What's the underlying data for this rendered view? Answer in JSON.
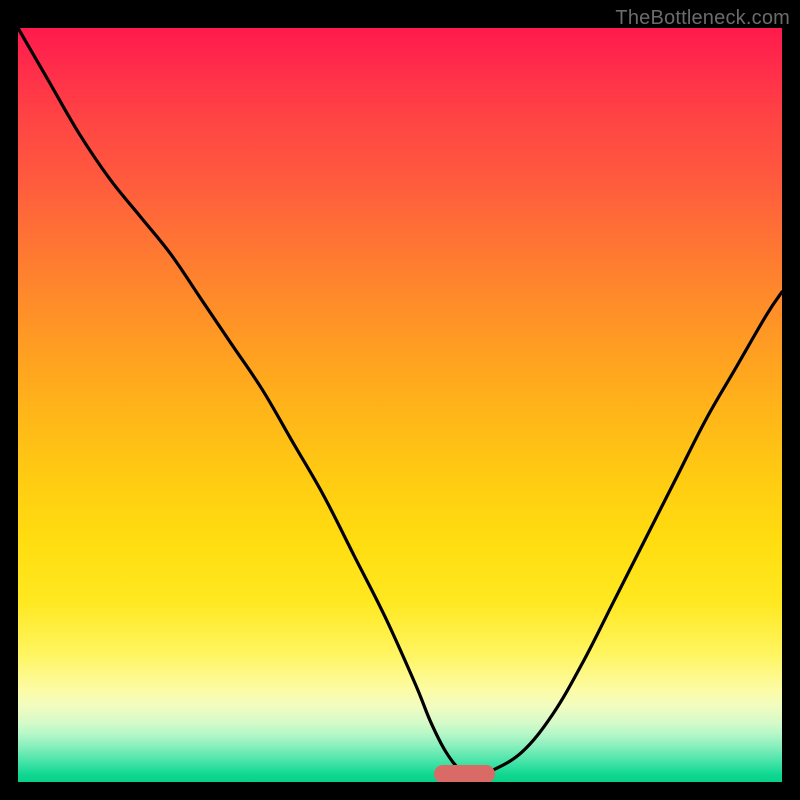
{
  "watermark": "TheBottleneck.com",
  "colors": {
    "background": "#000000",
    "curve_stroke": "#000000",
    "marker": "#d96a65",
    "watermark_text": "#6b6b6b"
  },
  "chart_data": {
    "type": "line",
    "title": "",
    "xlabel": "",
    "ylabel": "",
    "xlim": [
      0,
      100
    ],
    "ylim": [
      0,
      100
    ],
    "grid": false,
    "series": [
      {
        "name": "bottleneck-curve",
        "x": [
          0,
          4,
          8,
          12,
          16,
          20,
          24,
          28,
          32,
          36,
          40,
          44,
          48,
          52,
          54,
          56,
          58,
          60,
          62,
          66,
          70,
          74,
          78,
          82,
          86,
          90,
          94,
          98,
          100
        ],
        "values": [
          100,
          93,
          86,
          80,
          75,
          70,
          64,
          58,
          52,
          45,
          38,
          30,
          22,
          13,
          8,
          4,
          1.5,
          1,
          1.5,
          4,
          9,
          16,
          24,
          32,
          40,
          48,
          55,
          62,
          65
        ]
      }
    ],
    "marker": {
      "x_center": 58.5,
      "x_width": 8,
      "y": 1
    }
  }
}
